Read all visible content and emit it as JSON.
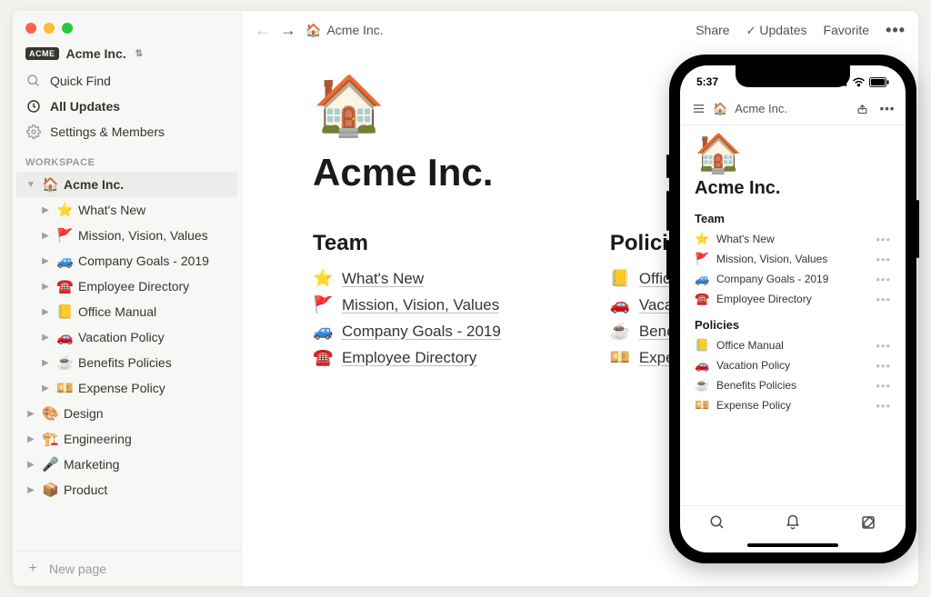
{
  "workspace": {
    "name": "Acme Inc."
  },
  "sidebar": {
    "quick_find": "Quick Find",
    "all_updates": "All Updates",
    "settings": "Settings & Members",
    "section_label": "WORKSPACE",
    "root_page": {
      "icon": "🏠",
      "label": "Acme Inc."
    },
    "children": [
      {
        "icon": "⭐",
        "label": "What's New"
      },
      {
        "icon": "🚩",
        "label": "Mission, Vision, Values"
      },
      {
        "icon": "🚙",
        "label": "Company Goals - 2019"
      },
      {
        "icon": "☎️",
        "label": "Employee Directory"
      },
      {
        "icon": "📒",
        "label": "Office Manual"
      },
      {
        "icon": "🚗",
        "label": "Vacation Policy"
      },
      {
        "icon": "☕",
        "label": "Benefits Policies"
      },
      {
        "icon": "💴",
        "label": "Expense Policy"
      }
    ],
    "siblings": [
      {
        "icon": "🎨",
        "label": "Design"
      },
      {
        "icon": "🏗️",
        "label": "Engineering"
      },
      {
        "icon": "🎤",
        "label": "Marketing"
      },
      {
        "icon": "📦",
        "label": "Product"
      }
    ],
    "new_page": "New page"
  },
  "topbar": {
    "breadcrumb_icon": "🏠",
    "breadcrumb": "Acme Inc.",
    "share": "Share",
    "updates": "Updates",
    "favorite": "Favorite"
  },
  "page": {
    "icon": "🏠",
    "title": "Acme Inc.",
    "columns": [
      {
        "heading": "Team",
        "items": [
          {
            "icon": "⭐",
            "label": "What's New"
          },
          {
            "icon": "🚩",
            "label": "Mission, Vision, Values"
          },
          {
            "icon": "🚙",
            "label": "Company Goals - 2019"
          },
          {
            "icon": "☎️",
            "label": "Employee Directory"
          }
        ]
      },
      {
        "heading": "Policies",
        "items": [
          {
            "icon": "📒",
            "label": "Office"
          },
          {
            "icon": "🚗",
            "label": "Vacati"
          },
          {
            "icon": "☕",
            "label": "Benefi"
          },
          {
            "icon": "💴",
            "label": "Expen"
          }
        ]
      }
    ]
  },
  "mobile": {
    "time": "5:37",
    "breadcrumb_icon": "🏠",
    "breadcrumb": "Acme Inc.",
    "title": "Acme Inc.",
    "sections": [
      {
        "heading": "Team",
        "items": [
          {
            "icon": "⭐",
            "label": "What's New"
          },
          {
            "icon": "🚩",
            "label": "Mission, Vision, Values"
          },
          {
            "icon": "🚙",
            "label": "Company Goals - 2019"
          },
          {
            "icon": "☎️",
            "label": "Employee Directory"
          }
        ]
      },
      {
        "heading": "Policies",
        "items": [
          {
            "icon": "📒",
            "label": "Office Manual"
          },
          {
            "icon": "🚗",
            "label": "Vacation Policy"
          },
          {
            "icon": "☕",
            "label": "Benefits Policies"
          },
          {
            "icon": "💴",
            "label": "Expense Policy"
          }
        ]
      }
    ]
  }
}
